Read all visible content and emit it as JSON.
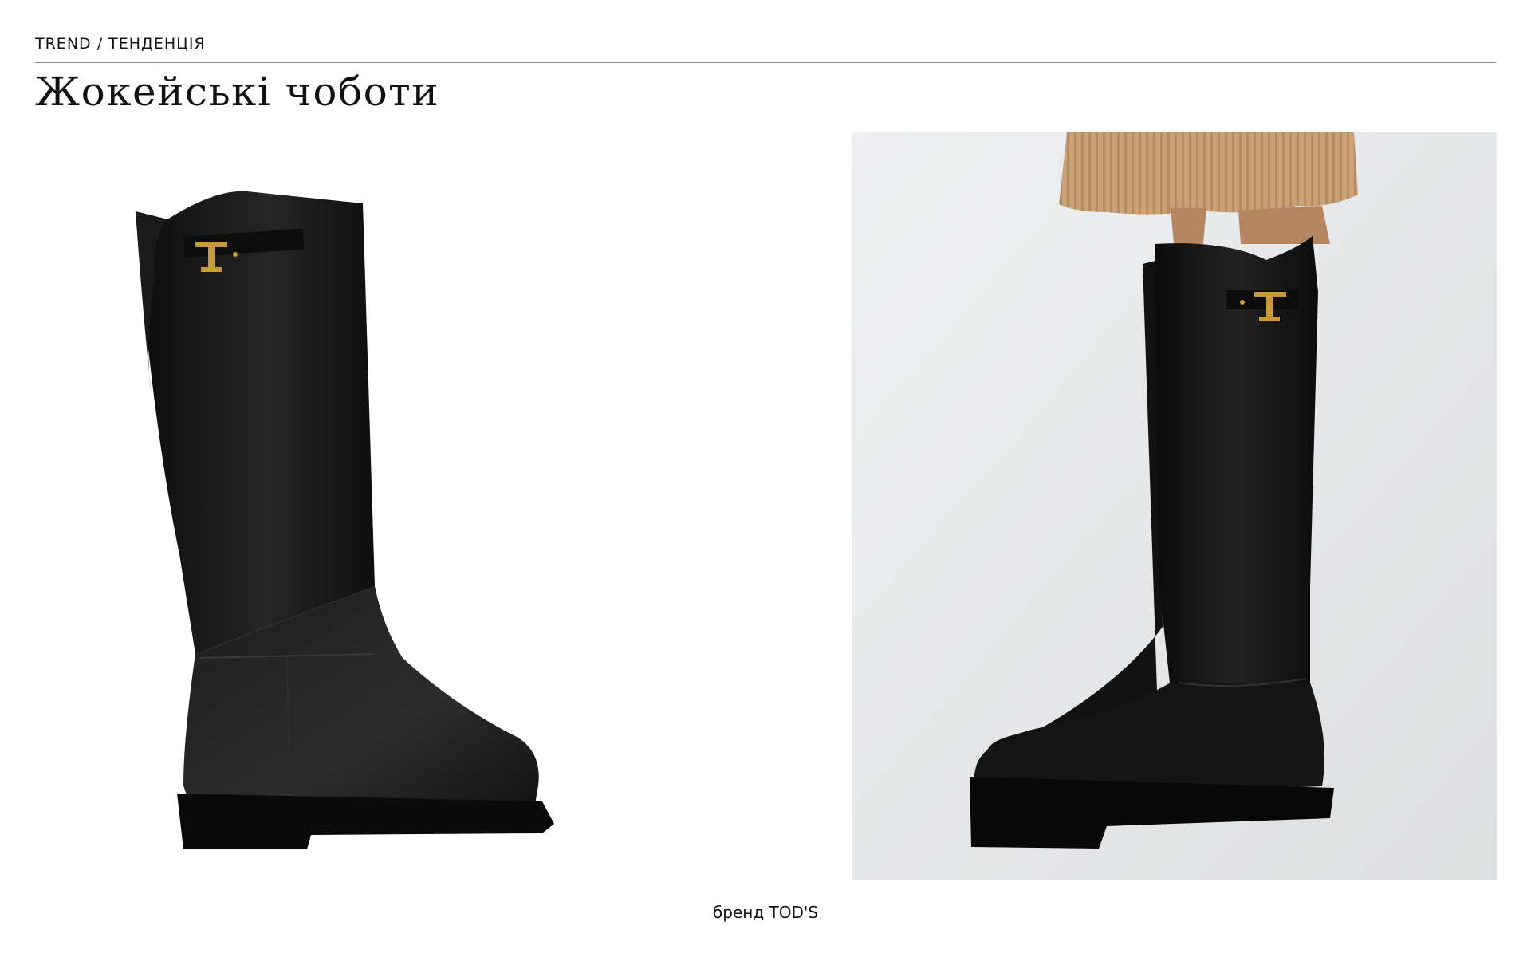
{
  "header": {
    "kicker": "TREND / ТЕНДЕНЦІЯ",
    "title": "Жокейські чоботи"
  },
  "images": {
    "product": "black-leather-riding-boot-product-shot",
    "model": "model-wearing-black-riding-boots-knit-skirt"
  },
  "colors": {
    "leather": "#151515",
    "buckle": "#c79a3a",
    "backdrop": "#e8e9ea",
    "skirt": "#caa178"
  },
  "footer": {
    "caption": "бренд TOD'S"
  }
}
